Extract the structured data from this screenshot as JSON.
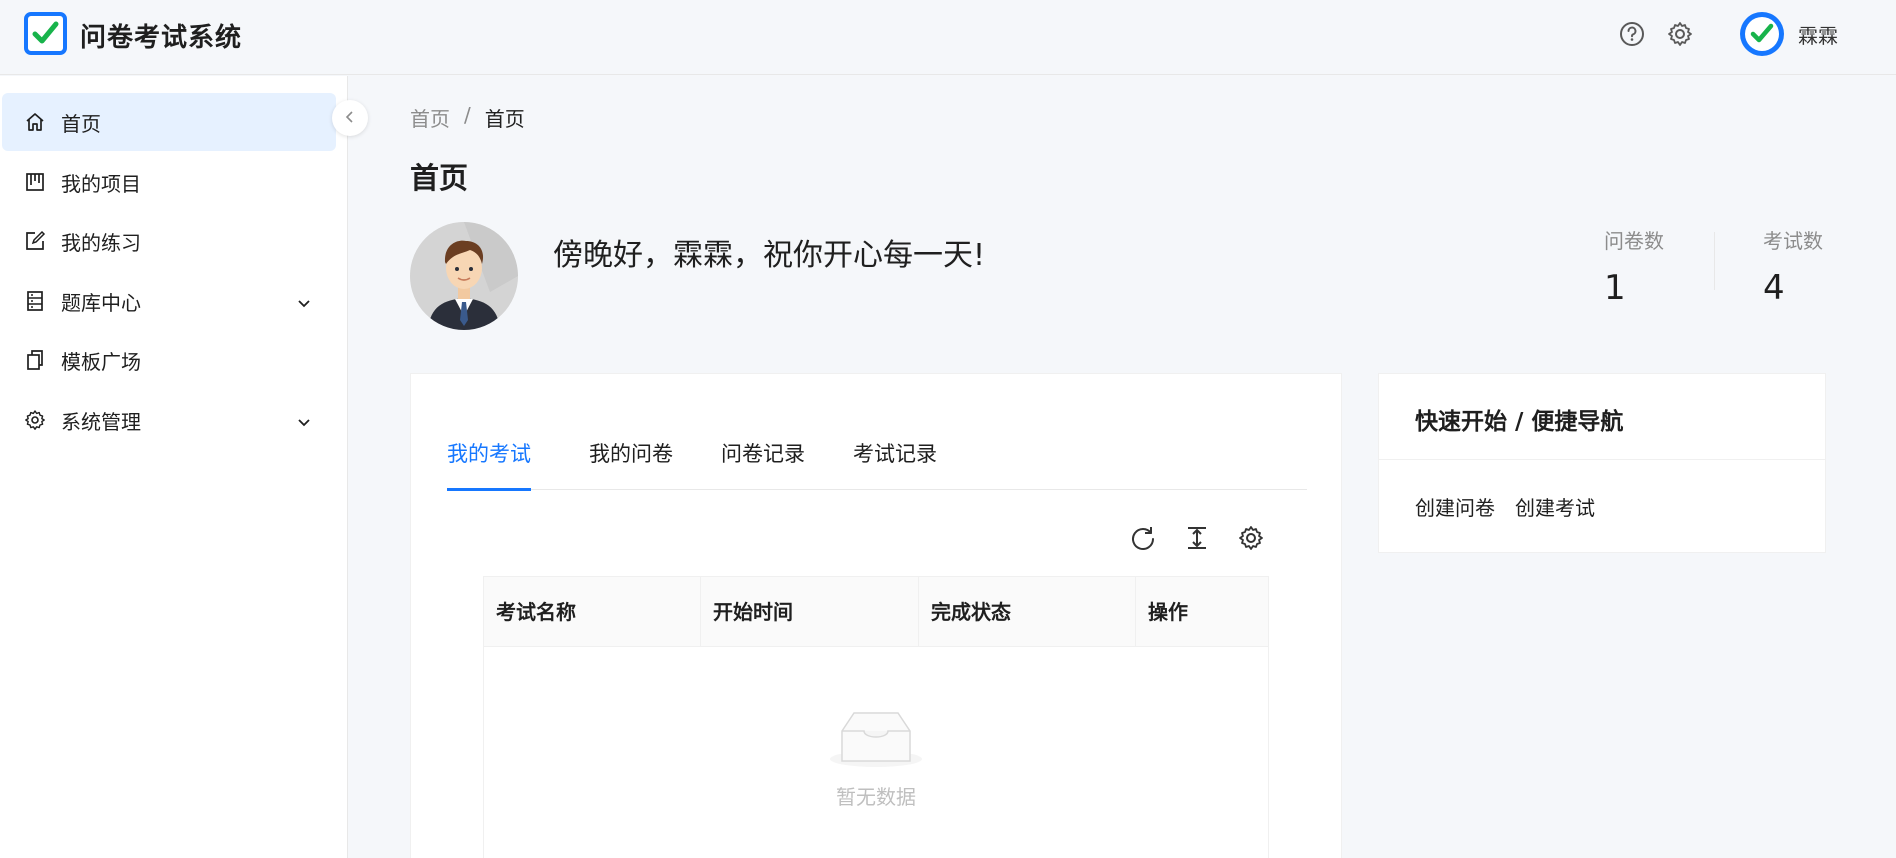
{
  "header": {
    "app_title": "问卷考试系统",
    "user_name": "霖霖",
    "brand_color": "#1677ff",
    "check_color": "#18b34b"
  },
  "sidebar": {
    "items": [
      {
        "label": "首页",
        "icon": "home-icon",
        "active": true
      },
      {
        "label": "我的项目",
        "icon": "project-icon"
      },
      {
        "label": "我的练习",
        "icon": "edit-icon"
      },
      {
        "label": "题库中心",
        "icon": "database-icon",
        "expandable": true
      },
      {
        "label": "模板广场",
        "icon": "copy-icon"
      },
      {
        "label": "系统管理",
        "icon": "gear-icon",
        "expandable": true
      }
    ]
  },
  "breadcrumb": {
    "items": [
      "首页",
      "首页"
    ],
    "separator": "/"
  },
  "page": {
    "title": "首页",
    "greeting": "傍晚好，霖霖，祝你开心每一天!"
  },
  "stats": [
    {
      "label": "问卷数",
      "value": "1"
    },
    {
      "label": "考试数",
      "value": "4"
    }
  ],
  "tabs": [
    {
      "label": "我的考试",
      "active": true
    },
    {
      "label": "我的问卷"
    },
    {
      "label": "问卷记录"
    },
    {
      "label": "考试记录"
    }
  ],
  "table": {
    "columns": [
      "考试名称",
      "开始时间",
      "完成状态",
      "操作"
    ],
    "rows": [],
    "empty_text": "暂无数据"
  },
  "quick": {
    "title": "快速开始 / 便捷导航",
    "links": [
      "创建问卷",
      "创建考试"
    ]
  }
}
